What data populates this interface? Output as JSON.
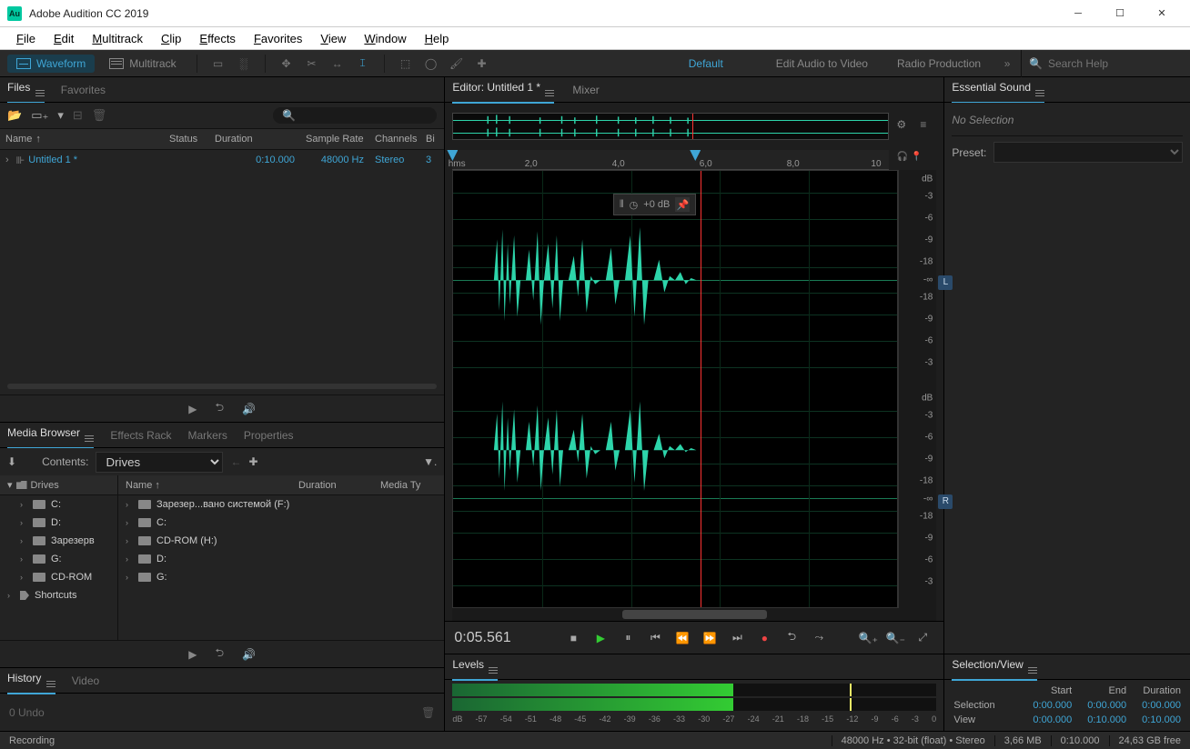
{
  "app": {
    "title": "Adobe Audition CC 2019",
    "logo": "Au"
  },
  "menu": [
    "File",
    "Edit",
    "Multitrack",
    "Clip",
    "Effects",
    "Favorites",
    "View",
    "Window",
    "Help"
  ],
  "workspace": {
    "views": {
      "waveform": "Waveform",
      "multitrack": "Multitrack"
    },
    "tabs": [
      "Default",
      "Edit Audio to Video",
      "Radio Production"
    ],
    "search_placeholder": "Search Help"
  },
  "files_panel": {
    "tabs": [
      "Files",
      "Favorites"
    ],
    "columns": {
      "name": "Name",
      "status": "Status",
      "duration": "Duration",
      "sr": "Sample Rate",
      "ch": "Channels",
      "bit": "Bi"
    },
    "sort_arrow": "↑",
    "rows": [
      {
        "name": "Untitled 1 *",
        "duration": "0:10.000",
        "sr": "48000 Hz",
        "ch": "Stereo",
        "bit": "3"
      }
    ]
  },
  "media_browser": {
    "tabs": [
      "Media Browser",
      "Effects Rack",
      "Markers",
      "Properties"
    ],
    "contents_label": "Contents:",
    "contents_value": "Drives",
    "tree_header": "Drives",
    "list_headers": {
      "name": "Name",
      "dur": "Duration",
      "mt": "Media Ty"
    },
    "tree": [
      {
        "label": "Drives",
        "icon": "folder",
        "exp": true
      },
      {
        "label": "C:",
        "icon": "drive",
        "indent": 1
      },
      {
        "label": "D:",
        "icon": "drive",
        "indent": 1
      },
      {
        "label": "Зарезерв",
        "icon": "drive",
        "indent": 1
      },
      {
        "label": "G:",
        "icon": "drive",
        "indent": 1
      },
      {
        "label": "CD-ROM",
        "icon": "drive",
        "indent": 1
      },
      {
        "label": "Shortcuts",
        "icon": "tag",
        "indent": 0
      }
    ],
    "list": [
      {
        "label": "Зарезер...вано системой (F:)",
        "icon": "drive"
      },
      {
        "label": "C:",
        "icon": "drive"
      },
      {
        "label": "CD-ROM (H:)",
        "icon": "drive"
      },
      {
        "label": "D:",
        "icon": "drive"
      },
      {
        "label": "G:",
        "icon": "drive"
      }
    ]
  },
  "history": {
    "tabs": [
      "History",
      "Video"
    ],
    "undo": "0 Undo"
  },
  "editor": {
    "tabs": [
      "Editor: Untitled 1 *",
      "Mixer"
    ],
    "ruler": {
      "unit": "hms",
      "marks": [
        "2,0",
        "4,0",
        "6,0",
        "8,0",
        "10"
      ]
    },
    "hud": "+0 dB",
    "channels": [
      "L",
      "R"
    ],
    "db_marks": [
      "dB",
      "-3",
      "-6",
      "-9",
      "-18",
      "-∞",
      "-18",
      "-9",
      "-6",
      "-3"
    ],
    "timecode": "0:05.561"
  },
  "levels": {
    "title": "Levels",
    "scale": [
      "dB",
      "-57",
      "-54",
      "-51",
      "-48",
      "-45",
      "-42",
      "-39",
      "-36",
      "-33",
      "-30",
      "-27",
      "-24",
      "-21",
      "-18",
      "-15",
      "-12",
      "-9",
      "-6",
      "-3",
      "0"
    ],
    "fill_pct": 58,
    "peak_pct": 82
  },
  "selview": {
    "title": "Selection/View",
    "cols": [
      "Start",
      "End",
      "Duration"
    ],
    "rows": [
      {
        "label": "Selection",
        "start": "0:00.000",
        "end": "0:00.000",
        "dur": "0:00.000"
      },
      {
        "label": "View",
        "start": "0:00.000",
        "end": "0:10.000",
        "dur": "0:10.000"
      }
    ]
  },
  "essential": {
    "title": "Essential Sound",
    "nosel": "No Selection",
    "preset_label": "Preset:"
  },
  "status": {
    "left": "Recording",
    "items": [
      "48000 Hz • 32-bit (float) • Stereo",
      "3,66 MB",
      "0:10.000",
      "24,63 GB free"
    ]
  }
}
